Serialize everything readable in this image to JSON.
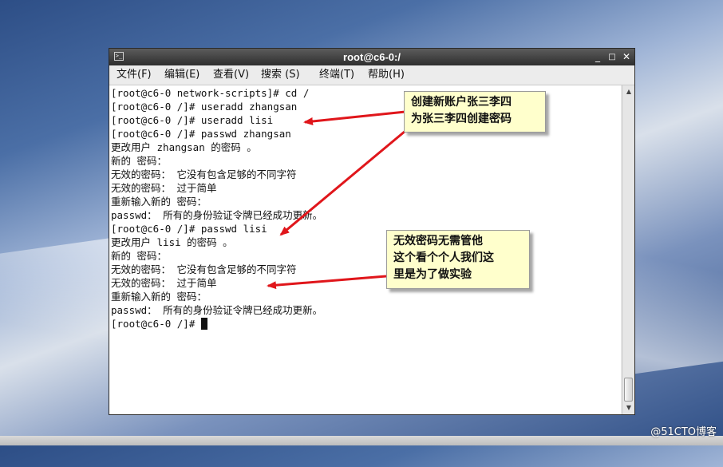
{
  "window": {
    "title": "root@c6-0:/",
    "controls": [
      "_",
      "□",
      "✕"
    ]
  },
  "menu": [
    "文件(F)",
    "编辑(E)",
    "查看(V)",
    "搜索 (S)",
    "终端(T)",
    "帮助(H)"
  ],
  "terminal": {
    "lines": [
      "[root@c6-0 network-scripts]# cd /",
      "[root@c6-0 /]# useradd zhangsan",
      "[root@c6-0 /]# useradd lisi",
      "[root@c6-0 /]# passwd zhangsan",
      "更改用户 zhangsan 的密码 。",
      "新的 密码：",
      "无效的密码： 它没有包含足够的不同字符",
      "无效的密码： 过于简单",
      "重新输入新的 密码：",
      "passwd： 所有的身份验证令牌已经成功更新。",
      "[root@c6-0 /]# passwd lisi",
      "更改用户 lisi 的密码 。",
      "新的 密码：",
      "无效的密码： 它没有包含足够的不同字符",
      "无效的密码： 过于简单",
      "重新输入新的 密码：",
      "passwd： 所有的身份验证令牌已经成功更新。",
      "[root@c6-0 /]# "
    ]
  },
  "annotations": {
    "top": [
      "创建新账户张三李四",
      "为张三李四创建密码"
    ],
    "bottom": [
      "无效密码无需管他",
      "这个看个个人我们这",
      "里是为了做实验"
    ],
    "arrow_color": "#e0161b"
  },
  "watermark": "@51CTO博客"
}
